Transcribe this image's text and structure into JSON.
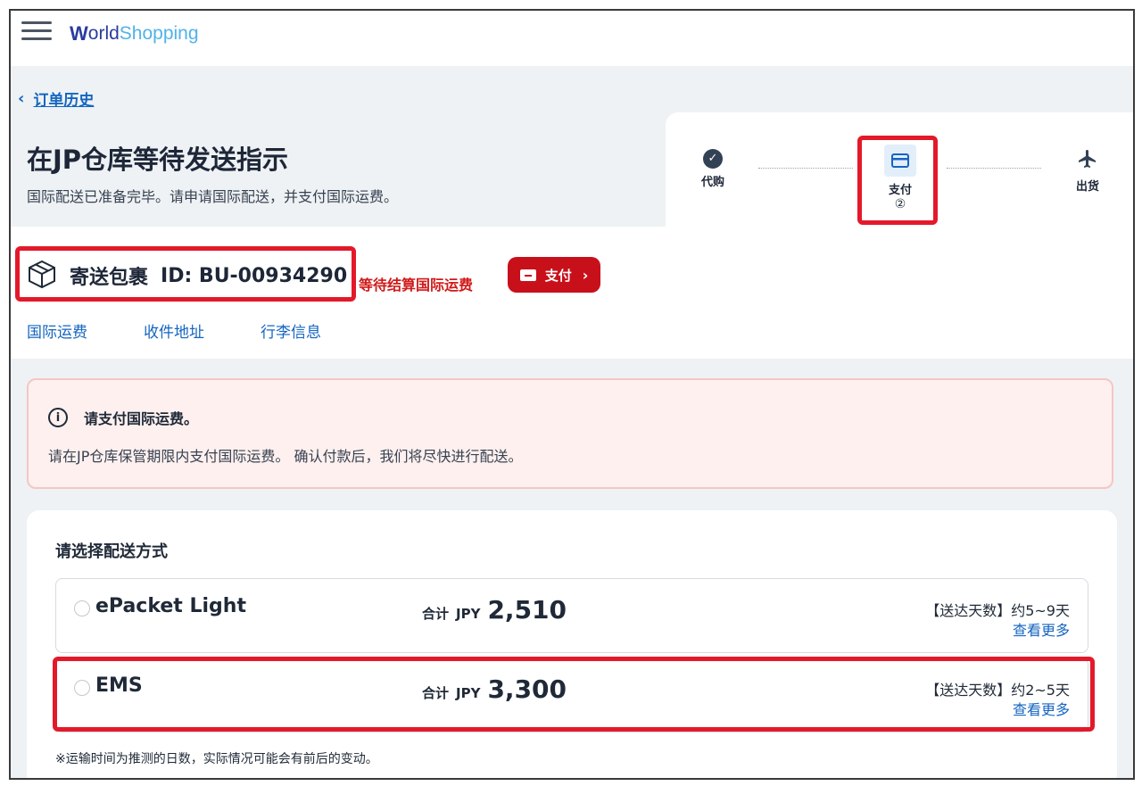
{
  "header": {
    "logo_w": "W",
    "logo_orld": "orld",
    "logo_shopping": "Shopping"
  },
  "nav": {
    "back_label": "订单历史"
  },
  "page": {
    "title": "在JP仓库等待发送指示",
    "subtitle": "国际配送已准备完毕。请申请国际配送，并支付国际运费。"
  },
  "steps": {
    "items": [
      {
        "label": "代购",
        "icon": "check-circle-icon"
      },
      {
        "label": "支付",
        "number": "②",
        "icon": "credit-card-icon"
      },
      {
        "label": "出货",
        "icon": "airplane-icon"
      }
    ]
  },
  "parcel": {
    "label": "寄送包裹",
    "id": "ID: BU-00934290",
    "status": "等待结算国际运费",
    "pay_button": "支付",
    "icon": "package-box-icon"
  },
  "tabs": [
    "国际运费",
    "收件地址",
    "行李信息"
  ],
  "alert": {
    "title": "请支付国际运费。",
    "body": "请在JP仓库保管期限内支付国际运费。 确认付款后，我们将尽快进行配送。",
    "icon": "info-icon"
  },
  "shipping": {
    "title": "请选择配送方式",
    "options": [
      {
        "name": "ePacket Light",
        "total_label": "合计",
        "currency": "JPY",
        "price": "2,510",
        "days": "【送达天数】约5~9天",
        "more": "查看更多"
      },
      {
        "name": "EMS",
        "total_label": "合计",
        "currency": "JPY",
        "price": "3,300",
        "days": "【送达天数】约2~5天",
        "more": "查看更多"
      }
    ],
    "note": "※运输时间为推测的日数，实际情况可能会有前后的变动。"
  },
  "colors": {
    "accent_red": "#c8101b",
    "highlight_red": "#e3192a",
    "link_blue": "#1565c0",
    "alert_bg": "#fdf0ee"
  }
}
